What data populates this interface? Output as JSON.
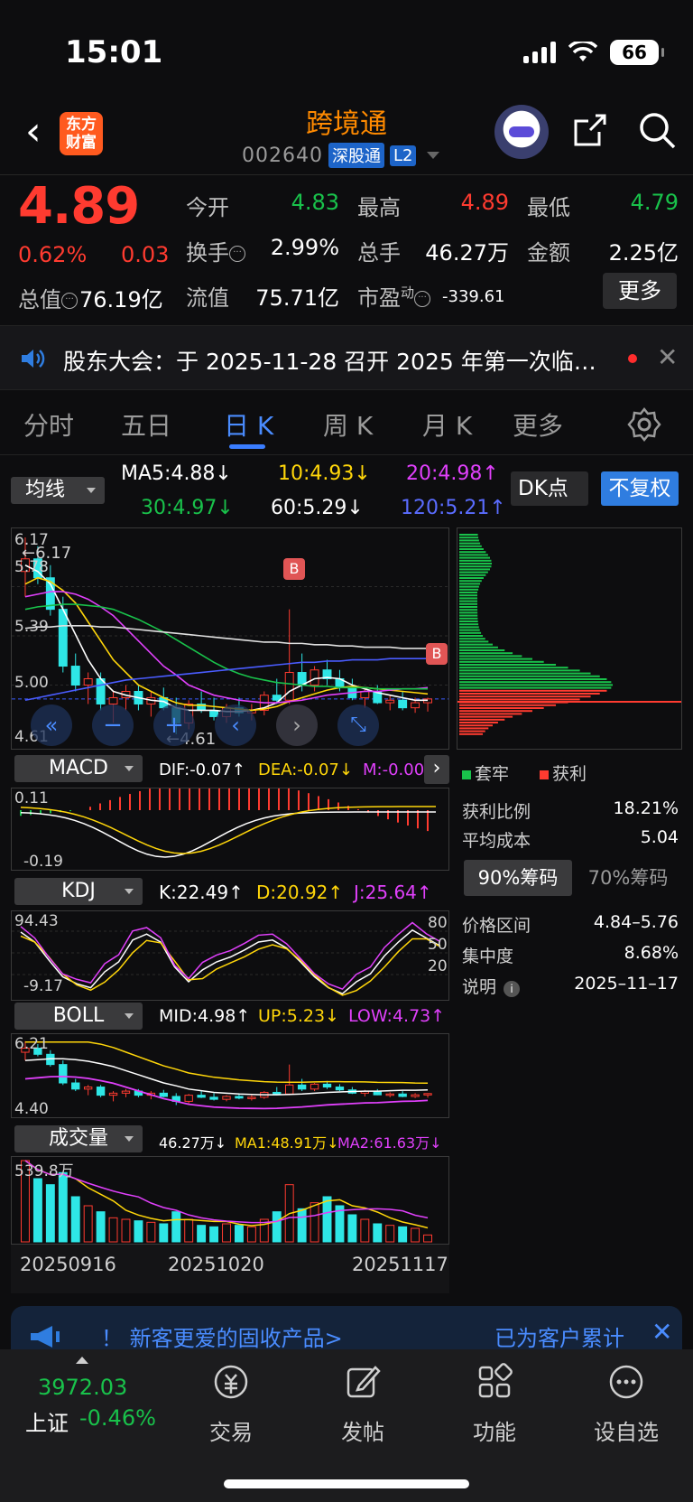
{
  "status": {
    "time": "15:01",
    "battery": "66"
  },
  "header": {
    "brand": "东方财富",
    "name": "跨境通",
    "code": "002640",
    "tag1": "深股通",
    "tag2": "L2"
  },
  "quote": {
    "price": "4.89",
    "pct": "0.62%",
    "change": "0.03",
    "total_value_label": "总值",
    "total_value": "76.19亿",
    "open_label": "今开",
    "open": "4.83",
    "high_label": "最高",
    "high": "4.89",
    "low_label": "最低",
    "low": "4.79",
    "turnover_label": "换手",
    "turnover": "2.99%",
    "volume_label": "总手",
    "volume": "46.27万",
    "amount_label": "金额",
    "amount": "2.25亿",
    "float_label": "流值",
    "float": "75.71亿",
    "pe_label": "市盈",
    "pe_sup": "动",
    "pe": "-339.61",
    "more": "更多"
  },
  "notice": {
    "text": "股东大会：于 2025-11-28 召开 2025 年第一次临…"
  },
  "tabs": [
    "分时",
    "五日",
    "日 K",
    "周 K",
    "月 K",
    "更多"
  ],
  "ma": {
    "select": "均线",
    "ma5": "MA5:4.88↓",
    "ma10": "10:4.93↓",
    "ma20": "20:4.98↑",
    "ma30": "30:4.97↓",
    "ma60": "60:5.29↓",
    "ma120": "120:5.21↑",
    "dk": "DK点",
    "fq": "不复权"
  },
  "kline": {
    "y_top": "6.17",
    "y_mid1": "5.78",
    "y_mid2": "5.39",
    "y_mid3": "5.00",
    "y_bottom": "4.61",
    "max_marker": "←6.17",
    "min_marker": "←4.61",
    "b_marker": "B"
  },
  "macd": {
    "select": "MACD",
    "dif": "DIF:-0.07↑",
    "dea": "DEA:-0.07↓",
    "m": "M:-0.00",
    "top": "0.11",
    "bottom": "-0.19"
  },
  "kdj": {
    "select": "KDJ",
    "k": "K:22.49↑",
    "d": "D:20.92↑",
    "j": "J:25.64↑",
    "top": "94.43",
    "bottom": "-9.17",
    "l80": "80",
    "l50": "50",
    "l20": "20"
  },
  "boll": {
    "select": "BOLL",
    "mid": "MID:4.98↑",
    "up": "UP:5.23↓",
    "low": "LOW:4.73↑",
    "top": "6.21",
    "bottom": "4.40"
  },
  "vol": {
    "select": "成交量",
    "vol": "46.27万↓",
    "ma1": "MA1:48.91万↓",
    "ma2": "MA2:61.63万↓",
    "top": "539.8万"
  },
  "dates": [
    "20250916",
    "20251020",
    "20251117"
  ],
  "chips": {
    "legend_trap": "套牢",
    "legend_profit": "获利",
    "profit_ratio_label": "获利比例",
    "profit_ratio": "18.21%",
    "avg_cost_label": "平均成本",
    "avg_cost": "5.04",
    "tab90": "90%筹码",
    "tab70": "70%筹码",
    "range_label": "价格区间",
    "range": "4.84–5.76",
    "conc_label": "集中度",
    "conc": "8.68%",
    "note_label": "说明",
    "note": "2025–11–17"
  },
  "ad": {
    "text": "！ 新客更爱的固收产品>",
    "right": "已为客户累计"
  },
  "bottom_nav": {
    "index_value": "3972.03",
    "index_name": "上证",
    "index_change": "-0.46%",
    "items": [
      "交易",
      "发帖",
      "功能",
      "设自选"
    ]
  },
  "chart_data": {
    "type": "candlestick",
    "xlabels": [
      "20250916",
      "20251020",
      "20251117"
    ],
    "ylim": [
      4.61,
      6.17
    ],
    "candles": [
      [
        5.9,
        6.17,
        5.7,
        6.0
      ],
      [
        6.0,
        6.1,
        5.8,
        5.85
      ],
      [
        5.85,
        5.95,
        5.55,
        5.6
      ],
      [
        5.6,
        5.7,
        5.1,
        5.15
      ],
      [
        5.15,
        5.25,
        4.95,
        5.0
      ],
      [
        5.0,
        5.1,
        4.85,
        5.05
      ],
      [
        5.05,
        5.1,
        4.8,
        4.85
      ],
      [
        4.85,
        4.95,
        4.7,
        4.9
      ],
      [
        4.9,
        5.0,
        4.8,
        4.95
      ],
      [
        4.95,
        5.0,
        4.8,
        4.85
      ],
      [
        4.85,
        4.95,
        4.75,
        4.9
      ],
      [
        4.9,
        4.98,
        4.8,
        4.82
      ],
      [
        4.82,
        4.9,
        4.61,
        4.7
      ],
      [
        4.7,
        4.88,
        4.65,
        4.85
      ],
      [
        4.85,
        4.95,
        4.78,
        4.8
      ],
      [
        4.8,
        4.9,
        4.72,
        4.75
      ],
      [
        4.75,
        4.85,
        4.7,
        4.82
      ],
      [
        4.82,
        4.9,
        4.75,
        4.78
      ],
      [
        4.78,
        4.85,
        4.72,
        4.8
      ],
      [
        4.8,
        4.95,
        4.76,
        4.92
      ],
      [
        4.92,
        5.05,
        4.85,
        4.88
      ],
      [
        4.88,
        5.6,
        4.85,
        5.1
      ],
      [
        5.1,
        5.25,
        4.95,
        5.0
      ],
      [
        5.0,
        5.15,
        4.95,
        5.12
      ],
      [
        5.12,
        5.2,
        5.0,
        5.05
      ],
      [
        5.05,
        5.12,
        4.95,
        4.98
      ],
      [
        4.98,
        5.05,
        4.88,
        4.9
      ],
      [
        4.9,
        4.98,
        4.82,
        4.95
      ],
      [
        4.95,
        5.0,
        4.85,
        4.86
      ],
      [
        4.86,
        4.92,
        4.8,
        4.88
      ],
      [
        4.88,
        4.95,
        4.8,
        4.82
      ],
      [
        4.82,
        4.9,
        4.78,
        4.86
      ],
      [
        4.86,
        4.9,
        4.79,
        4.89
      ]
    ],
    "ma5": [
      5.95,
      5.9,
      5.8,
      5.6,
      5.4,
      5.2,
      5.05,
      4.95,
      4.92,
      4.9,
      4.88,
      4.87,
      4.82,
      4.8,
      4.8,
      4.8,
      4.79,
      4.79,
      4.8,
      4.82,
      4.86,
      4.95,
      5.0,
      5.05,
      5.06,
      5.05,
      5.0,
      4.97,
      4.94,
      4.92,
      4.9,
      4.88,
      4.88
    ],
    "ma10": [
      5.8,
      5.85,
      5.82,
      5.75,
      5.65,
      5.5,
      5.35,
      5.2,
      5.1,
      5.0,
      4.95,
      4.9,
      4.86,
      4.84,
      4.84,
      4.83,
      4.82,
      4.81,
      4.8,
      4.81,
      4.83,
      4.87,
      4.9,
      4.93,
      4.96,
      4.98,
      4.99,
      4.98,
      4.97,
      4.96,
      4.95,
      4.94,
      4.93
    ],
    "ma20": [
      5.7,
      5.72,
      5.74,
      5.74,
      5.72,
      5.68,
      5.62,
      5.55,
      5.45,
      5.35,
      5.25,
      5.15,
      5.08,
      5.0,
      4.96,
      4.92,
      4.9,
      4.88,
      4.87,
      4.86,
      4.86,
      4.87,
      4.88,
      4.9,
      4.92,
      4.93,
      4.94,
      4.95,
      4.95,
      4.96,
      4.97,
      4.97,
      4.98
    ],
    "ma30": [
      5.6,
      5.62,
      5.63,
      5.64,
      5.64,
      5.63,
      5.62,
      5.6,
      5.56,
      5.52,
      5.47,
      5.42,
      5.36,
      5.3,
      5.24,
      5.18,
      5.13,
      5.09,
      5.06,
      5.04,
      5.02,
      5.01,
      5.0,
      4.99,
      4.99,
      4.98,
      4.98,
      4.98,
      4.97,
      4.97,
      4.97,
      4.97,
      4.97
    ],
    "ma60": [
      5.45,
      5.46,
      5.46,
      5.47,
      5.47,
      5.47,
      5.46,
      5.46,
      5.45,
      5.44,
      5.43,
      5.42,
      5.41,
      5.4,
      5.39,
      5.38,
      5.37,
      5.36,
      5.35,
      5.34,
      5.34,
      5.33,
      5.33,
      5.32,
      5.32,
      5.31,
      5.31,
      5.3,
      5.3,
      5.3,
      5.29,
      5.29,
      5.29
    ],
    "ma120": [
      4.88,
      4.9,
      4.92,
      4.94,
      4.96,
      4.98,
      5.0,
      5.02,
      5.04,
      5.05,
      5.06,
      5.07,
      5.08,
      5.09,
      5.1,
      5.11,
      5.12,
      5.13,
      5.14,
      5.15,
      5.16,
      5.17,
      5.18,
      5.18,
      5.19,
      5.19,
      5.2,
      5.2,
      5.2,
      5.21,
      5.21,
      5.21,
      5.21
    ]
  }
}
